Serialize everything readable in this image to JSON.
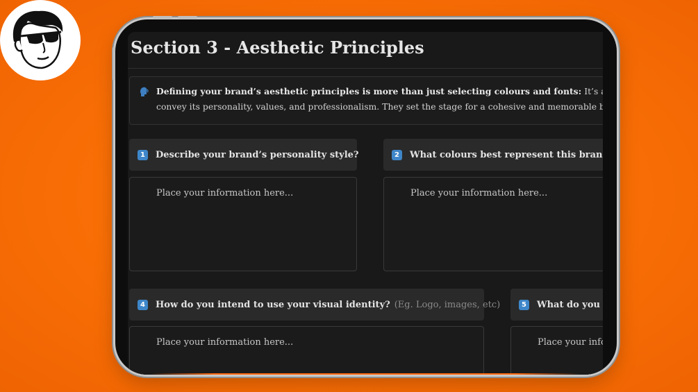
{
  "page": {
    "title": "Section 3 - Aesthetic Principles",
    "callout": {
      "icon": "speaking-head-icon",
      "bold": "Defining your brand’s aesthetic principles is more than just selecting colours and fonts:",
      "line1_rest": " It’s about creatin",
      "line2": "convey its personality, values, and professionalism. They set the stage for a cohesive and memorable brand ex"
    },
    "questions": [
      {
        "number": "1",
        "label": "Describe your brand’s personality style?",
        "hint": "",
        "placeholder": "Place your information here..."
      },
      {
        "number": "2",
        "label": "What colours best represent this brand?",
        "hint": "",
        "placeholder": "Place your information here..."
      },
      {
        "number": "4",
        "label": "How do you intend to use your visual identity?",
        "hint": "(Eg. Logo, images, etc)",
        "placeholder": "Place your information here..."
      },
      {
        "number": "5",
        "label": "What do you lik",
        "hint": "",
        "placeholder": "Place your infor"
      }
    ]
  },
  "colors": {
    "background": "#f86d05",
    "badge": "#3e86c9",
    "screen": "#191919",
    "header_card": "#2a2a2a"
  }
}
